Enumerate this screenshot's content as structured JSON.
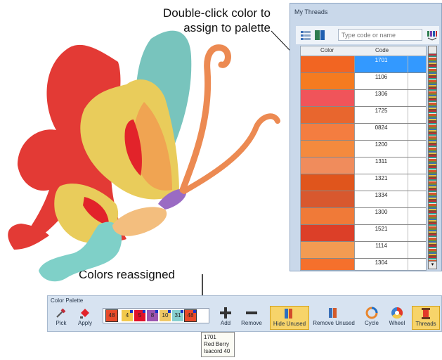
{
  "callouts": {
    "top_line1": "Double-click color to",
    "top_line2": "assign to palette",
    "bottom": "Colors reassigned"
  },
  "threads_window": {
    "title": "My Threads",
    "search_placeholder": "Type code or name",
    "columns": [
      "Color",
      "Code"
    ],
    "rows": [
      {
        "code": "1701",
        "color": "#f26522",
        "selected": true
      },
      {
        "code": "1106",
        "color": "#f57b20"
      },
      {
        "code": "1306",
        "color": "#f0545a"
      },
      {
        "code": "1725",
        "color": "#e8662e"
      },
      {
        "code": "0824",
        "color": "#f47d40"
      },
      {
        "code": "1200",
        "color": "#f48a3e"
      },
      {
        "code": "1311",
        "color": "#f08c5c"
      },
      {
        "code": "1321",
        "color": "#e0551c"
      },
      {
        "code": "1334",
        "color": "#d8582e"
      },
      {
        "code": "1300",
        "color": "#f07a38"
      },
      {
        "code": "1521",
        "color": "#dc3f28"
      },
      {
        "code": "1114",
        "color": "#f39b52"
      },
      {
        "code": "1304",
        "color": "#f5702c"
      }
    ]
  },
  "palette": {
    "title": "Color Palette",
    "tools": {
      "pick": "Pick",
      "apply": "Apply",
      "add": "Add",
      "remove": "Remove",
      "hide_unused": "Hide Unused",
      "remove_unused": "Remove Unused",
      "cycle": "Cycle",
      "wheel": "Wheel",
      "threads": "Threads"
    },
    "chips": [
      {
        "label": "48",
        "color": "#e84a2a",
        "marked": false,
        "highlight": true
      },
      {
        "label": "4",
        "color": "#f2c94c",
        "marked": true
      },
      {
        "label": "5",
        "color": "#e0102a",
        "marked": true
      },
      {
        "label": "8",
        "color": "#9b55b0",
        "marked": true
      },
      {
        "label": "10",
        "color": "#f0c866",
        "marked": true
      },
      {
        "label": "31",
        "color": "#86cfcf",
        "marked": true
      },
      {
        "label": "48",
        "color": "#e84a2a",
        "marked": true,
        "highlight": true
      }
    ]
  },
  "tooltip": {
    "line1": "1701",
    "line2": "Red Berry",
    "line3": "Isacord 40"
  }
}
